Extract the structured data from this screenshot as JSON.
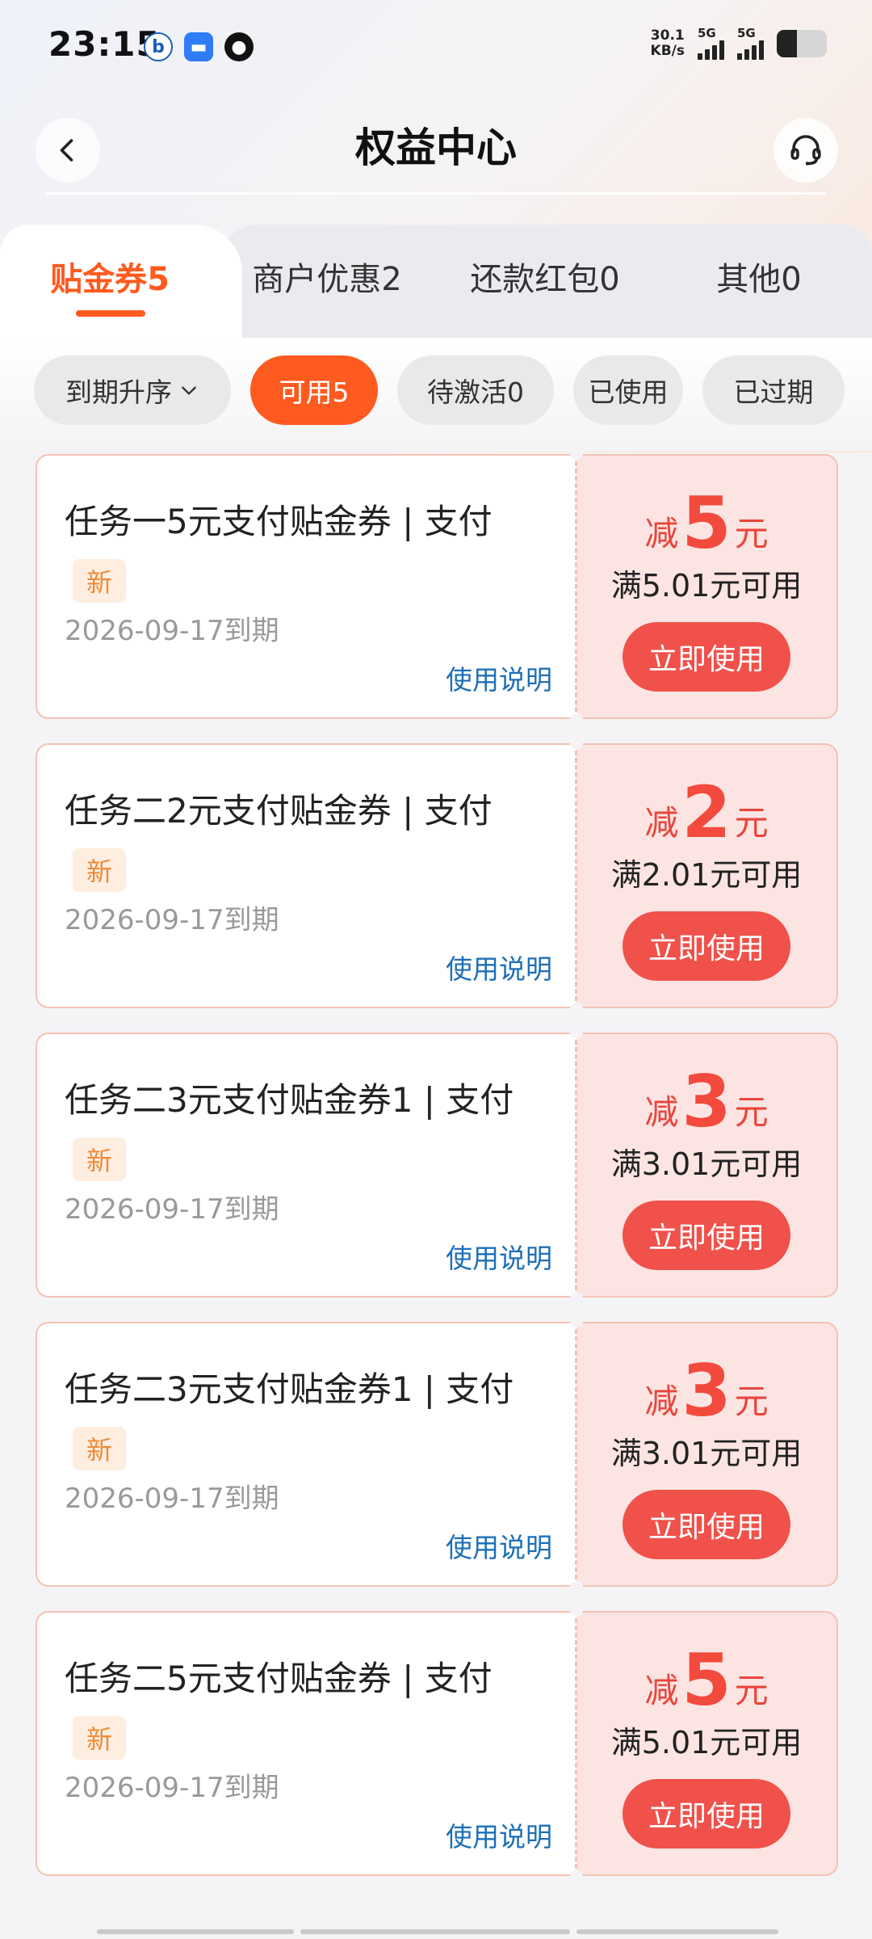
{
  "status": {
    "time": "23:15",
    "net_speed_value": "30.1",
    "net_speed_unit": "KB/s",
    "sim1": "5G",
    "sim2": "5G"
  },
  "header": {
    "title": "权益中心"
  },
  "tabs": [
    {
      "label": "贴金券5",
      "active": true
    },
    {
      "label": "商户优惠2",
      "active": false
    },
    {
      "label": "还款红包0",
      "active": false
    },
    {
      "label": "其他0",
      "active": false
    }
  ],
  "filters": {
    "sort_label": "到期升序",
    "chips": [
      "可用5",
      "待激活0",
      "已使用",
      "已过期"
    ]
  },
  "coupons": [
    {
      "title": "任务一5元支付贴金券 | 支付",
      "badge": "新",
      "expiry": "2026-09-17到期",
      "rules": "使用说明",
      "prefix": "减",
      "amount": "5",
      "unit": "元",
      "condition": "满5.01元可用",
      "use_label": "立即使用"
    },
    {
      "title": "任务二2元支付贴金券 | 支付",
      "badge": "新",
      "expiry": "2026-09-17到期",
      "rules": "使用说明",
      "prefix": "减",
      "amount": "2",
      "unit": "元",
      "condition": "满2.01元可用",
      "use_label": "立即使用"
    },
    {
      "title": "任务二3元支付贴金券1 | 支付",
      "badge": "新",
      "expiry": "2026-09-17到期",
      "rules": "使用说明",
      "prefix": "减",
      "amount": "3",
      "unit": "元",
      "condition": "满3.01元可用",
      "use_label": "立即使用"
    },
    {
      "title": "任务二3元支付贴金券1 | 支付",
      "badge": "新",
      "expiry": "2026-09-17到期",
      "rules": "使用说明",
      "prefix": "减",
      "amount": "3",
      "unit": "元",
      "condition": "满3.01元可用",
      "use_label": "立即使用"
    },
    {
      "title": "任务二5元支付贴金券 | 支付",
      "badge": "新",
      "expiry": "2026-09-17到期",
      "rules": "使用说明",
      "prefix": "减",
      "amount": "5",
      "unit": "元",
      "condition": "满5.01元可用",
      "use_label": "立即使用"
    }
  ],
  "colors": {
    "accent": "#ff5a1f",
    "coupon_red": "#f0514a",
    "link_blue": "#1d6fb8"
  }
}
